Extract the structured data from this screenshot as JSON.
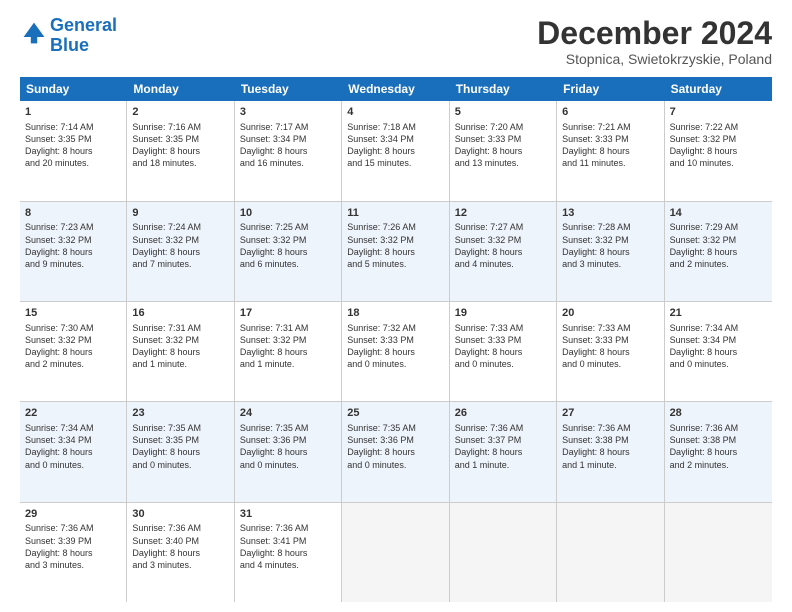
{
  "header": {
    "logo_line1": "General",
    "logo_line2": "Blue",
    "month": "December 2024",
    "location": "Stopnica, Swietokrzyskie, Poland"
  },
  "weekdays": [
    "Sunday",
    "Monday",
    "Tuesday",
    "Wednesday",
    "Thursday",
    "Friday",
    "Saturday"
  ],
  "rows": [
    [
      {
        "day": "1",
        "lines": [
          "Sunrise: 7:14 AM",
          "Sunset: 3:35 PM",
          "Daylight: 8 hours",
          "and 20 minutes."
        ]
      },
      {
        "day": "2",
        "lines": [
          "Sunrise: 7:16 AM",
          "Sunset: 3:35 PM",
          "Daylight: 8 hours",
          "and 18 minutes."
        ]
      },
      {
        "day": "3",
        "lines": [
          "Sunrise: 7:17 AM",
          "Sunset: 3:34 PM",
          "Daylight: 8 hours",
          "and 16 minutes."
        ]
      },
      {
        "day": "4",
        "lines": [
          "Sunrise: 7:18 AM",
          "Sunset: 3:34 PM",
          "Daylight: 8 hours",
          "and 15 minutes."
        ]
      },
      {
        "day": "5",
        "lines": [
          "Sunrise: 7:20 AM",
          "Sunset: 3:33 PM",
          "Daylight: 8 hours",
          "and 13 minutes."
        ]
      },
      {
        "day": "6",
        "lines": [
          "Sunrise: 7:21 AM",
          "Sunset: 3:33 PM",
          "Daylight: 8 hours",
          "and 11 minutes."
        ]
      },
      {
        "day": "7",
        "lines": [
          "Sunrise: 7:22 AM",
          "Sunset: 3:32 PM",
          "Daylight: 8 hours",
          "and 10 minutes."
        ]
      }
    ],
    [
      {
        "day": "8",
        "lines": [
          "Sunrise: 7:23 AM",
          "Sunset: 3:32 PM",
          "Daylight: 8 hours",
          "and 9 minutes."
        ]
      },
      {
        "day": "9",
        "lines": [
          "Sunrise: 7:24 AM",
          "Sunset: 3:32 PM",
          "Daylight: 8 hours",
          "and 7 minutes."
        ]
      },
      {
        "day": "10",
        "lines": [
          "Sunrise: 7:25 AM",
          "Sunset: 3:32 PM",
          "Daylight: 8 hours",
          "and 6 minutes."
        ]
      },
      {
        "day": "11",
        "lines": [
          "Sunrise: 7:26 AM",
          "Sunset: 3:32 PM",
          "Daylight: 8 hours",
          "and 5 minutes."
        ]
      },
      {
        "day": "12",
        "lines": [
          "Sunrise: 7:27 AM",
          "Sunset: 3:32 PM",
          "Daylight: 8 hours",
          "and 4 minutes."
        ]
      },
      {
        "day": "13",
        "lines": [
          "Sunrise: 7:28 AM",
          "Sunset: 3:32 PM",
          "Daylight: 8 hours",
          "and 3 minutes."
        ]
      },
      {
        "day": "14",
        "lines": [
          "Sunrise: 7:29 AM",
          "Sunset: 3:32 PM",
          "Daylight: 8 hours",
          "and 2 minutes."
        ]
      }
    ],
    [
      {
        "day": "15",
        "lines": [
          "Sunrise: 7:30 AM",
          "Sunset: 3:32 PM",
          "Daylight: 8 hours",
          "and 2 minutes."
        ]
      },
      {
        "day": "16",
        "lines": [
          "Sunrise: 7:31 AM",
          "Sunset: 3:32 PM",
          "Daylight: 8 hours",
          "and 1 minute."
        ]
      },
      {
        "day": "17",
        "lines": [
          "Sunrise: 7:31 AM",
          "Sunset: 3:32 PM",
          "Daylight: 8 hours",
          "and 1 minute."
        ]
      },
      {
        "day": "18",
        "lines": [
          "Sunrise: 7:32 AM",
          "Sunset: 3:33 PM",
          "Daylight: 8 hours",
          "and 0 minutes."
        ]
      },
      {
        "day": "19",
        "lines": [
          "Sunrise: 7:33 AM",
          "Sunset: 3:33 PM",
          "Daylight: 8 hours",
          "and 0 minutes."
        ]
      },
      {
        "day": "20",
        "lines": [
          "Sunrise: 7:33 AM",
          "Sunset: 3:33 PM",
          "Daylight: 8 hours",
          "and 0 minutes."
        ]
      },
      {
        "day": "21",
        "lines": [
          "Sunrise: 7:34 AM",
          "Sunset: 3:34 PM",
          "Daylight: 8 hours",
          "and 0 minutes."
        ]
      }
    ],
    [
      {
        "day": "22",
        "lines": [
          "Sunrise: 7:34 AM",
          "Sunset: 3:34 PM",
          "Daylight: 8 hours",
          "and 0 minutes."
        ]
      },
      {
        "day": "23",
        "lines": [
          "Sunrise: 7:35 AM",
          "Sunset: 3:35 PM",
          "Daylight: 8 hours",
          "and 0 minutes."
        ]
      },
      {
        "day": "24",
        "lines": [
          "Sunrise: 7:35 AM",
          "Sunset: 3:36 PM",
          "Daylight: 8 hours",
          "and 0 minutes."
        ]
      },
      {
        "day": "25",
        "lines": [
          "Sunrise: 7:35 AM",
          "Sunset: 3:36 PM",
          "Daylight: 8 hours",
          "and 0 minutes."
        ]
      },
      {
        "day": "26",
        "lines": [
          "Sunrise: 7:36 AM",
          "Sunset: 3:37 PM",
          "Daylight: 8 hours",
          "and 1 minute."
        ]
      },
      {
        "day": "27",
        "lines": [
          "Sunrise: 7:36 AM",
          "Sunset: 3:38 PM",
          "Daylight: 8 hours",
          "and 1 minute."
        ]
      },
      {
        "day": "28",
        "lines": [
          "Sunrise: 7:36 AM",
          "Sunset: 3:38 PM",
          "Daylight: 8 hours",
          "and 2 minutes."
        ]
      }
    ],
    [
      {
        "day": "29",
        "lines": [
          "Sunrise: 7:36 AM",
          "Sunset: 3:39 PM",
          "Daylight: 8 hours",
          "and 3 minutes."
        ]
      },
      {
        "day": "30",
        "lines": [
          "Sunrise: 7:36 AM",
          "Sunset: 3:40 PM",
          "Daylight: 8 hours",
          "and 3 minutes."
        ]
      },
      {
        "day": "31",
        "lines": [
          "Sunrise: 7:36 AM",
          "Sunset: 3:41 PM",
          "Daylight: 8 hours",
          "and 4 minutes."
        ]
      },
      null,
      null,
      null,
      null
    ]
  ]
}
